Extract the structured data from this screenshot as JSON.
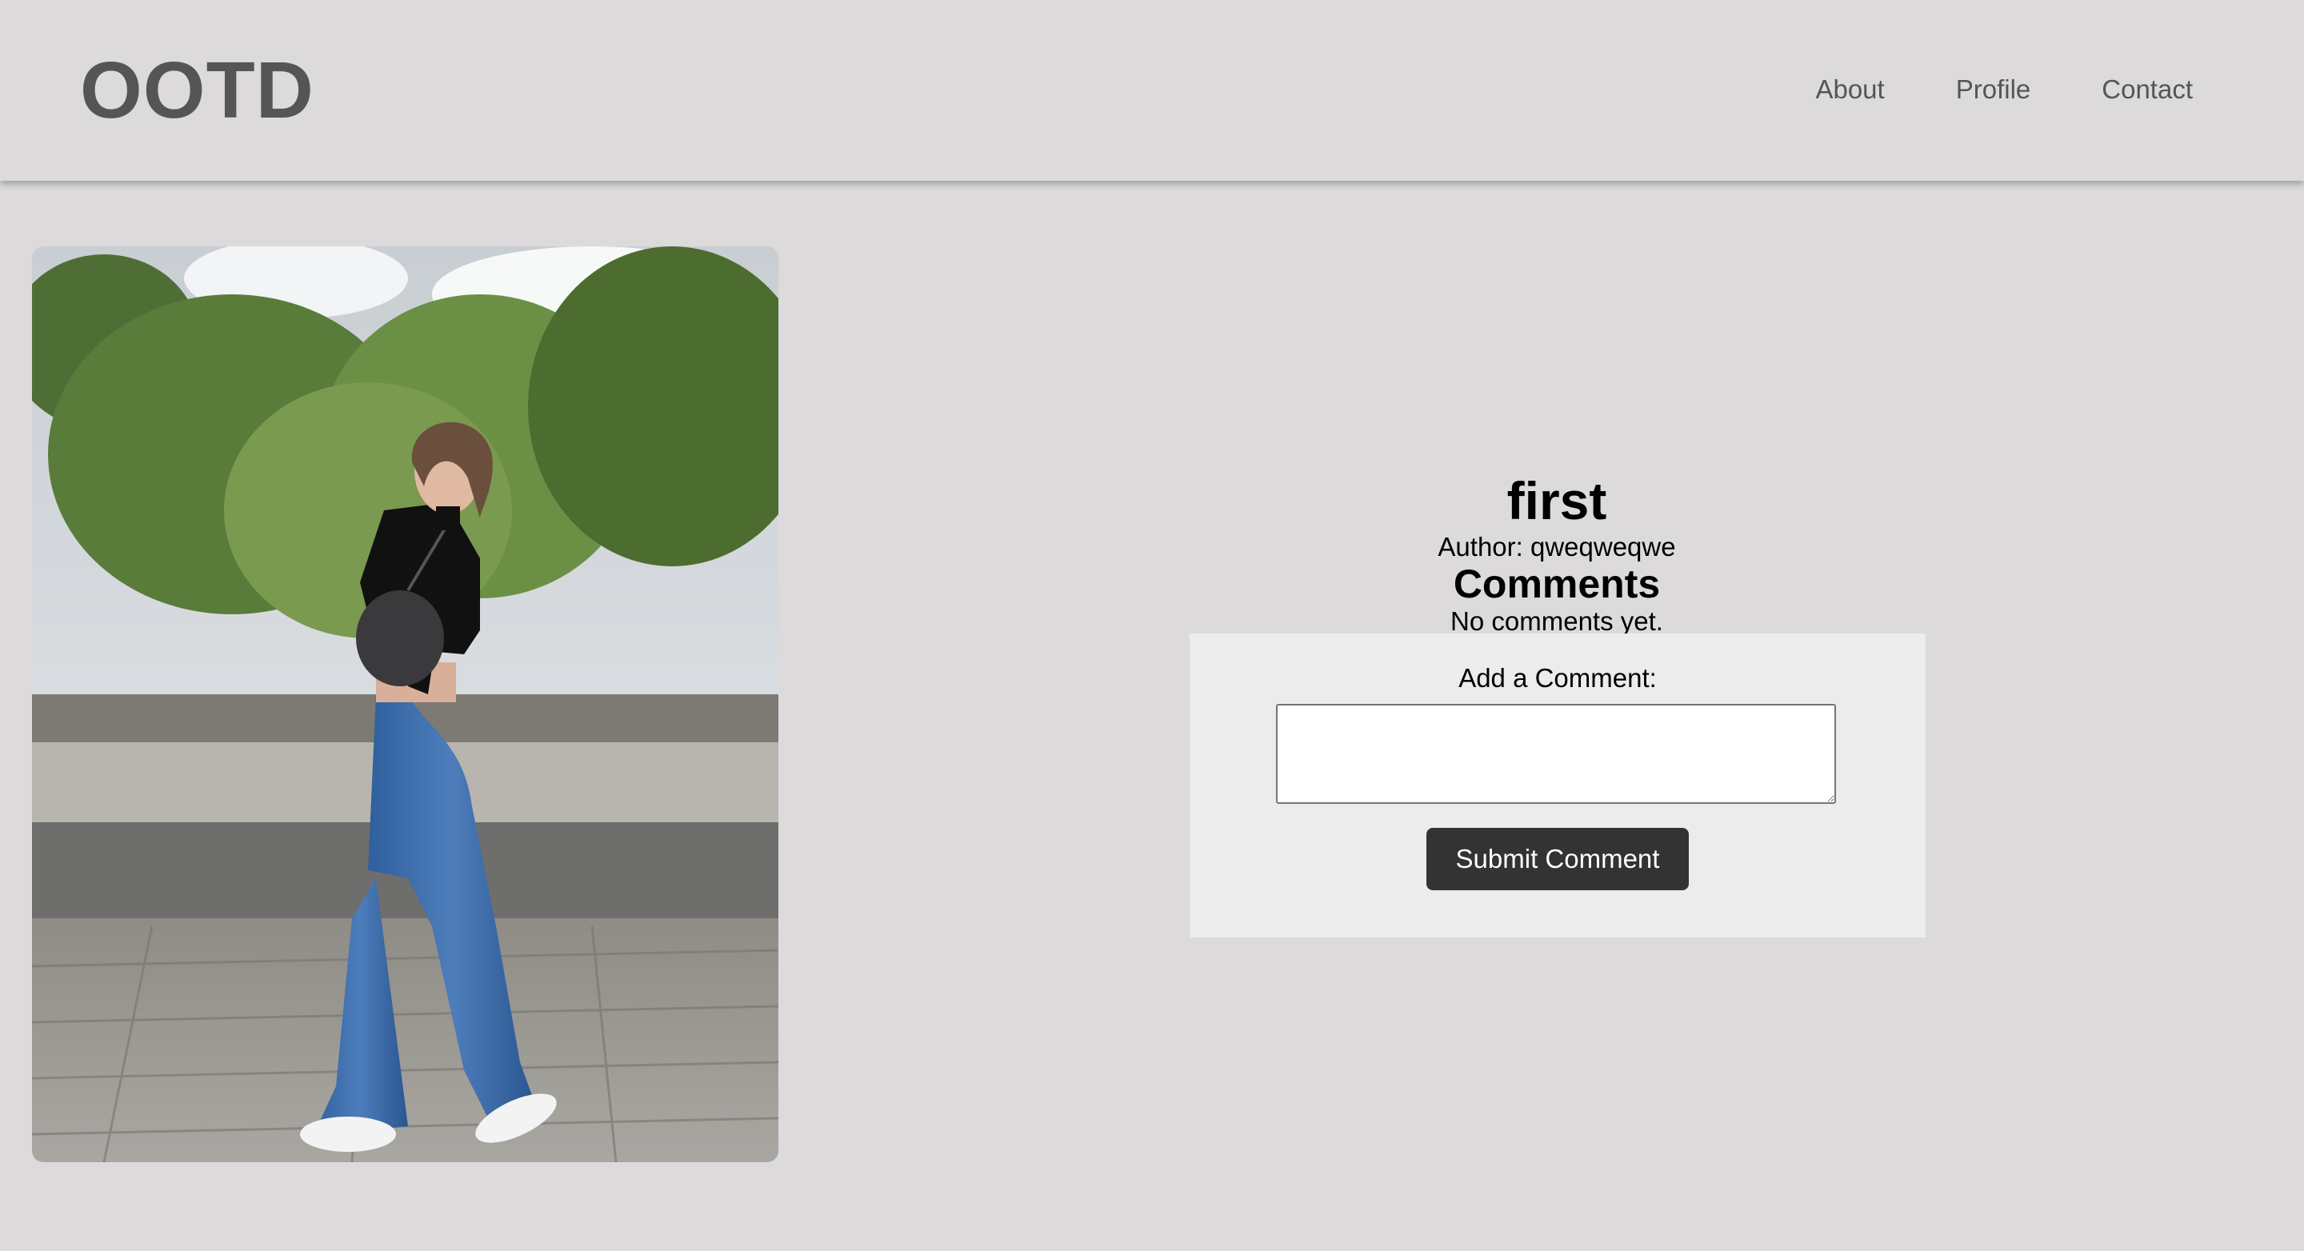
{
  "header": {
    "logo": "OOTD",
    "nav": [
      {
        "label": "About"
      },
      {
        "label": "Profile"
      },
      {
        "label": "Contact"
      }
    ]
  },
  "post": {
    "title": "first",
    "author": "Author: qweqweqwe",
    "comments_heading": "Comments",
    "no_comments": "No comments yet."
  },
  "comment_form": {
    "label": "Add a Comment:",
    "textarea_value": "",
    "submit_label": "Submit Comment"
  },
  "colors": {
    "background": "#dcdadb",
    "header_text": "#555555",
    "form_background": "#ececec",
    "button_background": "#333333",
    "button_text": "#ffffff"
  }
}
